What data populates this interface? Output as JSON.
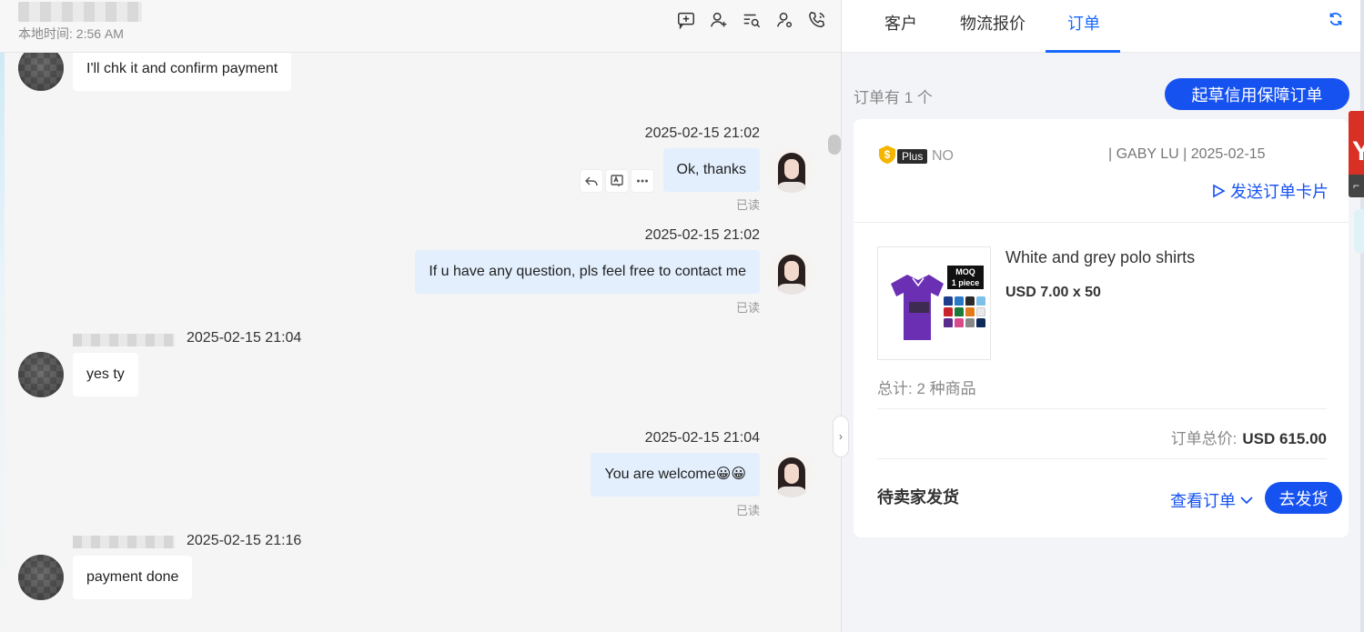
{
  "chat": {
    "local_time": "本地时间: 2:56 AM",
    "header_icons": [
      "add-note-icon",
      "add-contact-icon",
      "search-records-icon",
      "contact-settings-icon",
      "call-icon"
    ],
    "messages": [
      {
        "side": "in",
        "text": "I'll chk it and confirm payment"
      },
      {
        "side": "out",
        "time": "2025-02-15 21:02",
        "text": "Ok, thanks",
        "status": "已读"
      },
      {
        "side": "out",
        "time": "2025-02-15 21:02",
        "text": "If u have any question, pls feel free to contact me",
        "status": "已读"
      },
      {
        "side": "in",
        "time": "2025-02-15 21:04",
        "text": "yes ty"
      },
      {
        "side": "out",
        "time": "2025-02-15 21:04",
        "text": "You are welcome😀😀",
        "status": "已读"
      },
      {
        "side": "in",
        "time": "2025-02-15 21:16",
        "text": "payment done"
      }
    ],
    "message_action_icons": [
      "reply-icon",
      "translate-icon",
      "more-icon"
    ]
  },
  "panel": {
    "tabs": [
      "客户",
      "物流报价",
      "订单"
    ],
    "active_tab": "订单",
    "order_count": "订单有 1 个",
    "draft_button": "起草信用保障订单",
    "order": {
      "plus_label": "Plus",
      "order_no": "NO",
      "meta": "| GABY LU | 2025-02-15",
      "send_card": "发送订单卡片",
      "product_name": "White and grey polo shirts",
      "product_price": "USD 7.00 x 50",
      "moq_label": "MOQ",
      "moq_qty": "1 piece",
      "total_items": "总计: 2 种商品",
      "total_label": "订单总价:",
      "total_value": "USD 615.00",
      "status": "待卖家发货",
      "view_order": "查看订单",
      "ship_button": "去发货"
    }
  },
  "colors": {
    "accent": "#1652f0",
    "tab_active": "#1769ff",
    "outgoing_bubble": "#e3effd",
    "incoming_bubble": "#ffffff"
  }
}
